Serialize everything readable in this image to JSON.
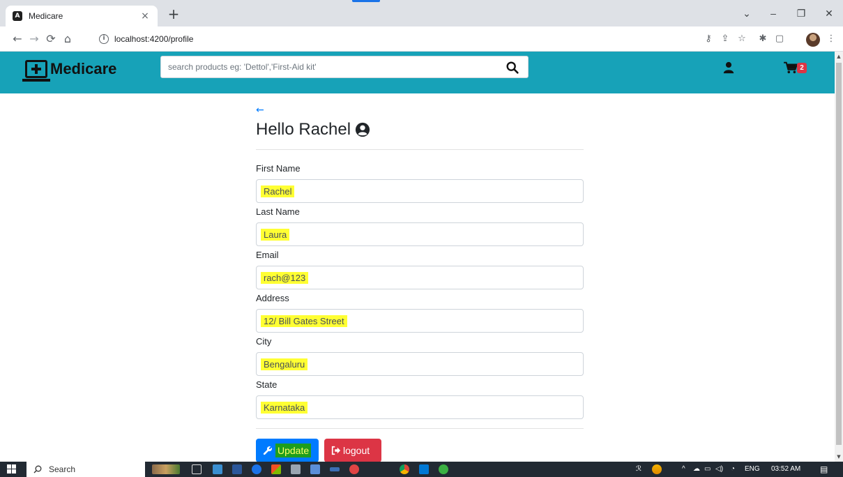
{
  "browser": {
    "tab_title": "Medicare",
    "tab_close": "×",
    "new_tab": "+",
    "url": "localhost:4200/profile",
    "window_controls": {
      "dropdown": "⌄",
      "minimize": "–",
      "restore": "❐",
      "close": "✕"
    }
  },
  "app": {
    "brand": "Medicare",
    "search_placeholder": "search products eg: 'Dettol','First-Aid kit'",
    "cart_count": "2",
    "colors": {
      "navbar": "#17a2b8",
      "primary": "#007bff",
      "danger": "#dc3545",
      "highlight": "#ffff33"
    }
  },
  "profile": {
    "back_arrow": "←",
    "greeting": "Hello Rachel",
    "fields": [
      {
        "label": "First Name",
        "value": "Rachel"
      },
      {
        "label": "Last Name",
        "value": "Laura"
      },
      {
        "label": "Email",
        "value": "rach@123"
      },
      {
        "label": "Address",
        "value": "12/ Bill Gates Street"
      },
      {
        "label": "City",
        "value": "Bengaluru"
      },
      {
        "label": "State",
        "value": "Karnataka"
      }
    ],
    "update_label": "Update",
    "logout_label": "logout"
  },
  "taskbar": {
    "search_label": "Search",
    "language": "ENG",
    "time": "03:52 AM"
  }
}
